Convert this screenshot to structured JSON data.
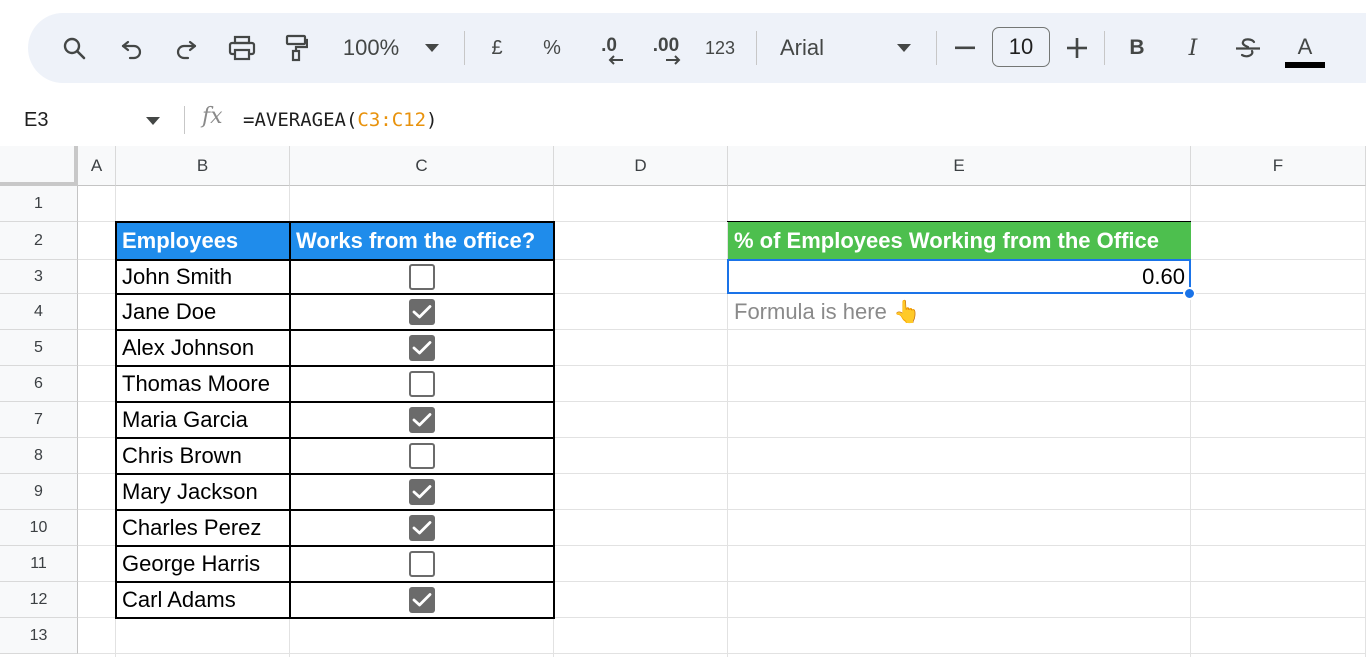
{
  "toolbar": {
    "zoom": "100%",
    "currency": "£",
    "percent": "%",
    "decrease_decimal": ".0",
    "increase_decimal": ".00",
    "number_format": "123",
    "font_name": "Arial",
    "font_size": "10",
    "bold": "B",
    "italic": "I",
    "text_color": "A",
    "text_color_value": "#000000"
  },
  "formula_bar": {
    "name_box": "E3",
    "fx": "fx",
    "formula_prefix": "=AVERAGEA(",
    "formula_ref": "C3:C12",
    "formula_suffix": ")"
  },
  "grid": {
    "columns": [
      "A",
      "B",
      "C",
      "D",
      "E",
      "F"
    ],
    "rows": [
      "1",
      "2",
      "3",
      "4",
      "5",
      "6",
      "7",
      "8",
      "9",
      "10",
      "11",
      "12",
      "13"
    ]
  },
  "table": {
    "header_employees": "Employees",
    "header_office": "Works from the office?",
    "header_color": "#1f8ceb",
    "rows": [
      {
        "name": "John Smith",
        "checked": false
      },
      {
        "name": "Jane Doe",
        "checked": true
      },
      {
        "name": "Alex Johnson",
        "checked": true
      },
      {
        "name": "Thomas Moore",
        "checked": false
      },
      {
        "name": "Maria Garcia",
        "checked": true
      },
      {
        "name": "Chris Brown",
        "checked": false
      },
      {
        "name": "Mary Jackson",
        "checked": true
      },
      {
        "name": "Charles Perez",
        "checked": true
      },
      {
        "name": "George Harris",
        "checked": false
      },
      {
        "name": "Carl Adams",
        "checked": true
      }
    ]
  },
  "result": {
    "header": "% of Employees Working from the Office",
    "header_color": "#4dbf4e",
    "value": "0.60",
    "note": "Formula is here 👆"
  },
  "selection_color": "#1a73e8"
}
